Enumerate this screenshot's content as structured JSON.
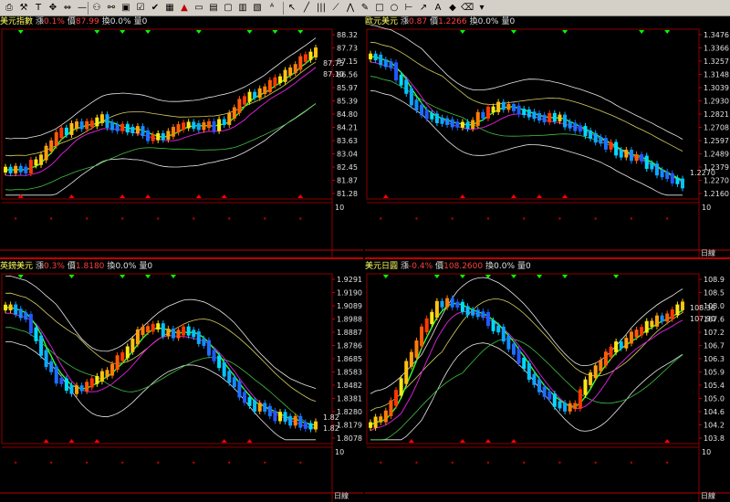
{
  "toolbar": {
    "icons": [
      "print-icon",
      "tools-icon",
      "text-icon",
      "move-icon",
      "arrows-icon",
      "line-icon",
      "glasses-icon",
      "binoculars-icon",
      "image-icon",
      "checkbox-icon",
      "check-icon",
      "grid-icon",
      "alert-icon",
      "monitor-icon",
      "table-icon",
      "window-icon",
      "chart-window-icon",
      "tile-icon",
      "text-abc-icon",
      "cursor-icon",
      "line-tool-icon",
      "bars-icon",
      "fan-icon",
      "zigzag-icon",
      "pencil-icon",
      "square-icon",
      "circle-icon",
      "ruler-icon",
      "arrow-line-icon",
      "font-icon",
      "mark-icon",
      "eraser-icon",
      "save-icon"
    ]
  },
  "colors": {
    "border": "#c00000",
    "up": "#ff0000",
    "down": "#00ff00",
    "frame": "#8b0000"
  },
  "panels": [
    {
      "name": "美元指數",
      "change_label": "漲",
      "change": "0.1%",
      "price_label": "價",
      "price": "87.99",
      "vol_change_label": "換",
      "vol_change": "0.0%",
      "vol_label": "量",
      "vol": "0",
      "y_ticks": [
        "88.32",
        "87.73",
        "87.15",
        "86.56",
        "85.97",
        "85.39",
        "84.80",
        "84.21",
        "83.63",
        "83.04",
        "82.45",
        "81.87",
        "81.28"
      ],
      "sub_tick": "10",
      "sub_label": "",
      "current_tags": [
        "87.75",
        "87.10"
      ]
    },
    {
      "name": "歐元美元",
      "change_label": "漲",
      "change": "0.87",
      "price_label": "價",
      "price": "1.2266",
      "vol_change_label": "換",
      "vol_change": "0.0%",
      "vol_label": "量",
      "vol": "0",
      "y_ticks": [
        "1.3476",
        "1.3366",
        "1.3257",
        "1.3148",
        "1.3039",
        "1.2930",
        "1.2821",
        "1.2708",
        "1.2597",
        "1.2489",
        "1.2379",
        "1.2270",
        "1.2160"
      ],
      "sub_tick": "10",
      "sub_label": "日線",
      "current_tags": [
        "1.2270"
      ]
    },
    {
      "name": "英鎊美元",
      "change_label": "漲",
      "change": "0.3%",
      "price_label": "價",
      "price": "1.8180",
      "vol_change_label": "換",
      "vol_change": "0.0%",
      "vol_label": "量",
      "vol": "0",
      "y_ticks": [
        "1.9291",
        "1.9190",
        "1.9089",
        "1.8988",
        "1.8887",
        "1.8786",
        "1.8685",
        "1.8583",
        "1.8482",
        "1.8381",
        "1.8280",
        "1.8179",
        "1.8078"
      ],
      "sub_tick": "10",
      "sub_label": "日線",
      "current_tags": [
        "1.82",
        "1.82"
      ]
    },
    {
      "name": "美元日圓",
      "change_label": "漲",
      "change": "-0.4%",
      "price_label": "價",
      "price": "108.2600",
      "vol_change_label": "換",
      "vol_change": "0.0%",
      "vol_label": "量",
      "vol": "0",
      "y_ticks": [
        "108.9",
        "108.5",
        "108.0",
        "107.6",
        "107.2",
        "106.7",
        "106.3",
        "105.9",
        "105.4",
        "105.0",
        "104.6",
        "104.2",
        "103.8"
      ],
      "sub_tick": "10",
      "sub_label": "日線",
      "current_tags": [
        "108.36",
        "107.90"
      ]
    }
  ]
}
